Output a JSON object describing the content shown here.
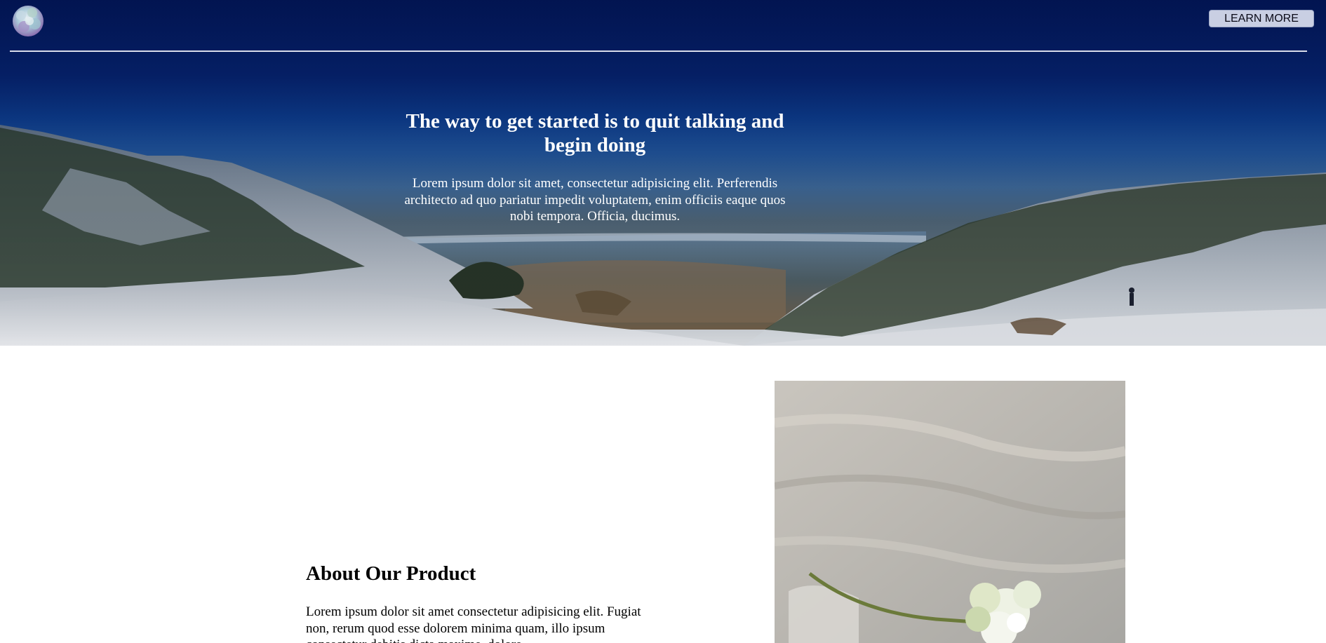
{
  "header": {
    "logo": "hydrangea-logo",
    "learn_more_label": "LEARN MORE"
  },
  "hero": {
    "title": "The way to get started is to quit talking and begin doing",
    "subtitle": "Lorem ipsum dolor sit amet, consectetur adipisicing elit. Perferendis architecto ad quo pariatur impedit voluptatem, enim officiis eaque quos nobi tempora. Officia, ducimus.",
    "background": "mountain-panorama-image"
  },
  "about": {
    "title": "About Our Product",
    "text": "Lorem ipsum dolor sit amet consectetur adipisicing elit. Fugiat non, rerum quod esse dolorem minima quam, illo ipsum consectetur debitis dicta maxime, dolore",
    "image": "white-hydrangea-photo"
  },
  "colors": {
    "sky_top": "#031a5c",
    "button_bg": "#c9cfe3",
    "text_dark": "#000000",
    "text_light": "#ffffff"
  }
}
